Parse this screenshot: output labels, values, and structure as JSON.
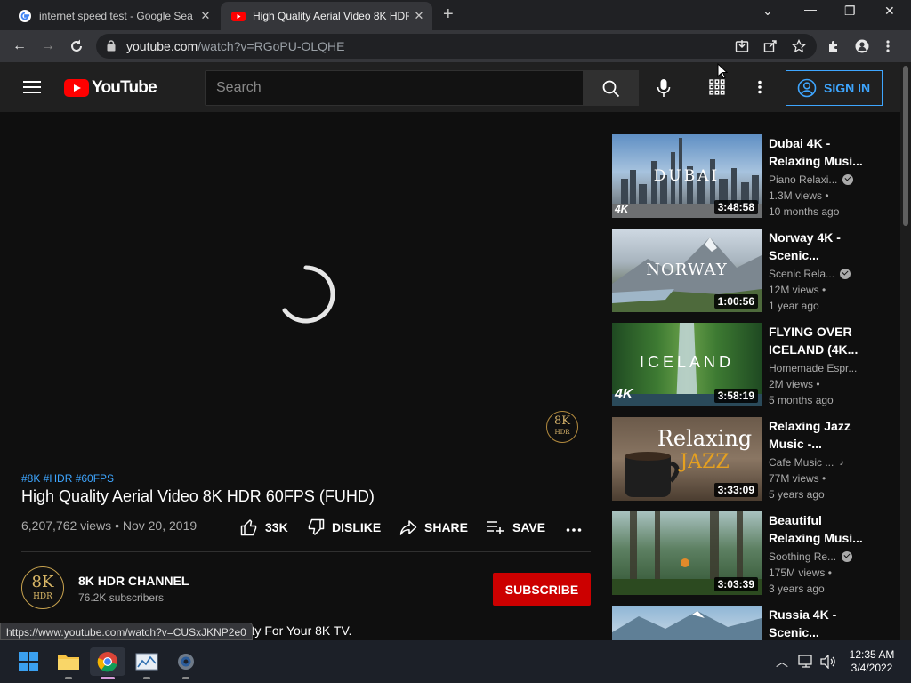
{
  "browser": {
    "tabs": [
      {
        "title": "internet speed test - Google Sea",
        "favicon": "google-icon",
        "active": false
      },
      {
        "title": "High Quality Aerial Video 8K HDR",
        "favicon": "youtube-icon",
        "active": true
      }
    ],
    "address": {
      "domain": "youtube.com",
      "path": "/watch?v=RGoPU-OLQHE"
    },
    "status_url": "https://www.youtube.com/watch?v=CUSxJKNP2e0"
  },
  "youtube": {
    "logo_text": "YouTube",
    "search_placeholder": "Search",
    "sign_in": "SIGN IN",
    "video": {
      "tags": "#8K #HDR #60FPS",
      "title": "High Quality Aerial Video 8K HDR 60FPS (FUHD)",
      "meta": "6,207,762 views • Nov 20, 2019",
      "likes": "33K",
      "dislike": "DISLIKE",
      "share": "SHARE",
      "save": "SAVE",
      "watermark_top": "8K",
      "watermark_bottom": "HDR"
    },
    "channel": {
      "name": "8K HDR CHANNEL",
      "subscribers": "76.2K subscribers",
      "avatar_top": "8K",
      "avatar_bottom": "HDR",
      "subscribe": "SUBSCRIBE"
    },
    "description": "ceptional 8K HDR 60FPS Quality For Your 8K TV.",
    "recommended": [
      {
        "title": "Dubai 4K - Relaxing Musi...",
        "channel": "Piano Relaxi...",
        "badge": "verified",
        "views": "1.3M views •",
        "age": "10 months ago",
        "duration": "3:48:58",
        "thumb_text": "DUBAI",
        "thumb_badge": "4K"
      },
      {
        "title": "Norway 4K - Scenic...",
        "channel": "Scenic Rela...",
        "badge": "verified",
        "views": "12M views •",
        "age": "1 year ago",
        "duration": "1:00:56",
        "thumb_text": "NORWAY"
      },
      {
        "title": "FLYING OVER ICELAND (4K...",
        "channel": "Homemade Espr...",
        "badge": "",
        "views": "2M views •",
        "age": "5 months ago",
        "duration": "3:58:19",
        "thumb_text": "ICELAND",
        "thumb_badge": "4K"
      },
      {
        "title": "Relaxing Jazz Music -...",
        "channel": "Cafe Music ...",
        "badge": "music",
        "views": "77M views •",
        "age": "5 years ago",
        "duration": "3:33:09",
        "thumb_text": "Relaxing",
        "thumb_text2": "JAZZ"
      },
      {
        "title": "Beautiful Relaxing Musi...",
        "channel": "Soothing Re...",
        "badge": "verified",
        "views": "175M views •",
        "age": "3 years ago",
        "duration": "3:03:39",
        "thumb_text": ""
      },
      {
        "title": "Russia 4K - Scenic...",
        "channel": "",
        "badge": "",
        "views": "",
        "age": "",
        "duration": "",
        "thumb_text": ""
      }
    ]
  },
  "taskbar": {
    "apps": [
      "windows-start-icon",
      "file-explorer-icon",
      "chrome-icon",
      "task-manager-icon",
      "settings-icon"
    ],
    "time": "12:35 AM",
    "date": "3/4/2022"
  },
  "colors": {
    "accent": "#3ea6ff",
    "subscribe": "#cc0000",
    "youtube_red": "#ff0000"
  }
}
